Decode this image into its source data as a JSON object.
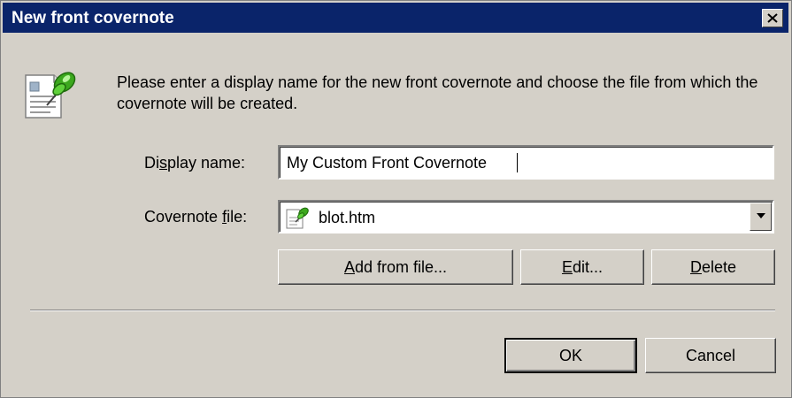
{
  "window": {
    "title": "New front covernote"
  },
  "instructions": "Please enter a display name for the new front covernote and choose the file from which the covernote will be created.",
  "display_name": {
    "label_pre": "Di",
    "label_mn": "s",
    "label_post": "play name:",
    "value": "My Custom Front Covernote"
  },
  "covernote_file": {
    "label_pre": "Covernote ",
    "label_mn": "f",
    "label_post": "ile:",
    "value": "blot.htm"
  },
  "buttons": {
    "add_mn": "A",
    "add_rest": "dd from file...",
    "edit_mn": "E",
    "edit_rest": "dit...",
    "delete_mn": "D",
    "delete_rest": "elete",
    "ok": "OK",
    "cancel": "Cancel"
  },
  "icons": {
    "dialog": "document-with-pushpin-icon",
    "file": "document-with-pushpin-icon",
    "close": "close-icon",
    "dropdown": "chevron-down-icon"
  },
  "colors": {
    "titlebar": "#0a246a",
    "face": "#d4d0c8",
    "pin": "#3ca81e"
  }
}
